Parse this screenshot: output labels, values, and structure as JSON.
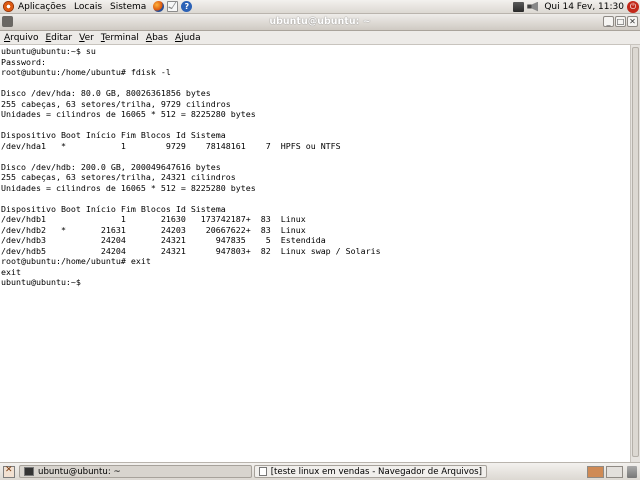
{
  "top_panel": {
    "menus": [
      "Aplicações",
      "Locais",
      "Sistema"
    ],
    "clock": "Qui 14 Fev, 11:30"
  },
  "window": {
    "title": "ubuntu@ubuntu: ~",
    "menus": [
      "Arquivo",
      "Editar",
      "Ver",
      "Terminal",
      "Abas",
      "Ajuda"
    ]
  },
  "terminal": {
    "lines": [
      "ubuntu@ubuntu:~$ su",
      "Password:",
      "root@ubuntu:/home/ubuntu# fdisk -l",
      "",
      "Disco /dev/hda: 80.0 GB, 80026361856 bytes",
      "255 cabeças, 63 setores/trilha, 9729 cilindros",
      "Unidades = cilindros de 16065 * 512 = 8225280 bytes",
      "",
      "Dispositivo Boot Início Fim Blocos Id Sistema",
      "/dev/hda1   *           1        9729    78148161    7  HPFS ou NTFS",
      "",
      "Disco /dev/hdb: 200.0 GB, 200049647616 bytes",
      "255 cabeças, 63 setores/trilha, 24321 cilindros",
      "Unidades = cilindros de 16065 * 512 = 8225280 bytes",
      "",
      "Dispositivo Boot Início Fim Blocos Id Sistema",
      "/dev/hdb1               1       21630   173742187+  83  Linux",
      "/dev/hdb2   *       21631       24203    20667622+  83  Linux",
      "/dev/hdb3           24204       24321      947835    5  Estendida",
      "/dev/hdb5           24204       24321      947803+  82  Linux swap / Solaris",
      "root@ubuntu:/home/ubuntu# exit",
      "exit",
      "ubuntu@ubuntu:~$"
    ]
  },
  "taskbar": {
    "tasks": [
      "ubuntu@ubuntu: ~",
      "[teste linux em vendas - Navegador de Arquivos]"
    ]
  },
  "colors": {
    "panel": "#dcd8d2",
    "terminal_bg": "#ffffff",
    "terminal_fg": "#000000",
    "ubuntu_orange": "#dd5a12"
  },
  "icons": [
    "ubuntu-logo-icon",
    "firefox-icon",
    "mail-icon",
    "help-icon",
    "network-icon",
    "volume-icon",
    "power-icon",
    "show-desktop-icon",
    "terminal-task-icon",
    "files-task-icon",
    "trash-icon"
  ]
}
